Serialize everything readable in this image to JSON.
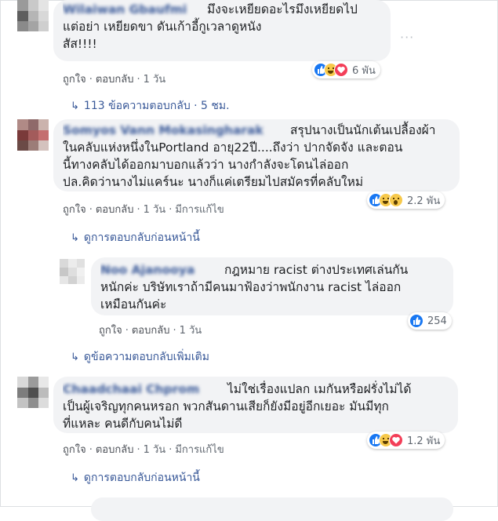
{
  "comments": [
    {
      "name": "Wilaiwan Gbaufmi",
      "text": "มึงจะเหยียดอะไรมึงเหยียดไปแต่อย่า เหยียดขา ดันเก้าอี้กูเวลาดูหนังสัส!!!!",
      "lines": [
        "มึงจะเหยียดอะไรมึงเหยียดไป",
        "แต่อย่า เหยียดขา ดันเก้าอี้กูเวลาดูหนัง",
        "สัส!!!!"
      ],
      "like": "ถูกใจ",
      "reply": "ตอบกลับ",
      "time": "1 วัน",
      "reaction_count": "6 พัน",
      "reactions": [
        "like",
        "haha",
        "love"
      ],
      "thread_link": "113 ข้อความตอบกลับ · 5 ชม."
    },
    {
      "name": "Somyos Vann Mokasingharak",
      "lines": [
        "สรุปนางเป็นนักเต้นเปลื้องผ้า",
        "ในคลับแห่งหนึ่งในPortland อายุ22ปี....ถึงว่า ปากจัดจัง และตอน",
        "นี้ทางคลับได้ออกมาบอกแล้วว่า นางกำลังจะโดนไล่ออก",
        "ปล.คิดว่านางไม่แคร์นะ นางก็แค่เตรียมไปสมัครที่คลับใหม่"
      ],
      "like": "ถูกใจ",
      "reply": "ตอบกลับ",
      "time": "1 วัน",
      "edited": "มีการแก้ไข",
      "reaction_count": "2.2 พัน",
      "reactions": [
        "like",
        "haha",
        "wow"
      ],
      "thread_link": "ดูการตอบกลับก่อนหน้านี้",
      "reply_item": {
        "name": "Noo Ajanooya",
        "lines": [
          "กฎหมาย racist ต่างประเทศเล่นกัน",
          "หนักค่ะ บริษัทเราถ้ามีคนมาฟ้องว่าพนักงาน racist ไล่ออก",
          "เหมือนกันค่ะ"
        ],
        "like": "ถูกใจ",
        "reply": "ตอบกลับ",
        "time": "1 วัน",
        "reaction_count": "254"
      },
      "more_link": "ดูข้อความตอบกลับเพิ่มเติม"
    },
    {
      "name": "Chaadchaai Chprom",
      "lines": [
        "ไม่ใช่เรื่องแปลก เมกันหรือฝรั่งไม่ได้",
        "เป็นผู้เจริญทุกคนหรอก พวกสันดานเสียก็ยังมีอยู่อีกเยอะ มันมีทุก",
        "ที่แหละ คนดีกับคนไม่ดี"
      ],
      "like": "ถูกใจ",
      "reply": "ตอบกลับ",
      "time": "1 วัน",
      "edited": "มีการแก้ไข",
      "reaction_count": "1.2 พัน",
      "reactions": [
        "like",
        "haha",
        "love"
      ],
      "thread_link": "ดูการตอบกลับก่อนหน้านี้"
    }
  ],
  "more_options": "···"
}
